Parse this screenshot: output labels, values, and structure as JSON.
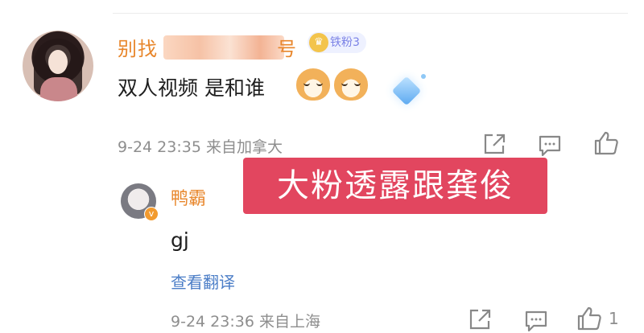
{
  "comment": {
    "username_visible_start": "别找",
    "username_visible_end": "号",
    "fan_badge": "铁粉3",
    "text": "双人视频 是和谁",
    "emoji_1": "dog-face-emoji",
    "emoji_2": "dog-face-emoji",
    "decoration": "diamond-sparkle-icon",
    "timestamp": "9-24 23:35",
    "location": "来自加拿大"
  },
  "overlay_caption": "大粉透露跟龚俊",
  "reply": {
    "username": "鸭霸",
    "text": "gj",
    "translate_link": "查看翻译",
    "timestamp": "9-24 23:36",
    "location": "来自上海",
    "like_count": "1"
  },
  "icons": {
    "share": "share-icon",
    "comment": "comment-icon",
    "like": "thumbs-up-icon"
  },
  "colors": {
    "username": "#e8862b",
    "link": "#4c7ec7",
    "caption_bg": "#e2465f",
    "meta": "#8e8e8e"
  }
}
